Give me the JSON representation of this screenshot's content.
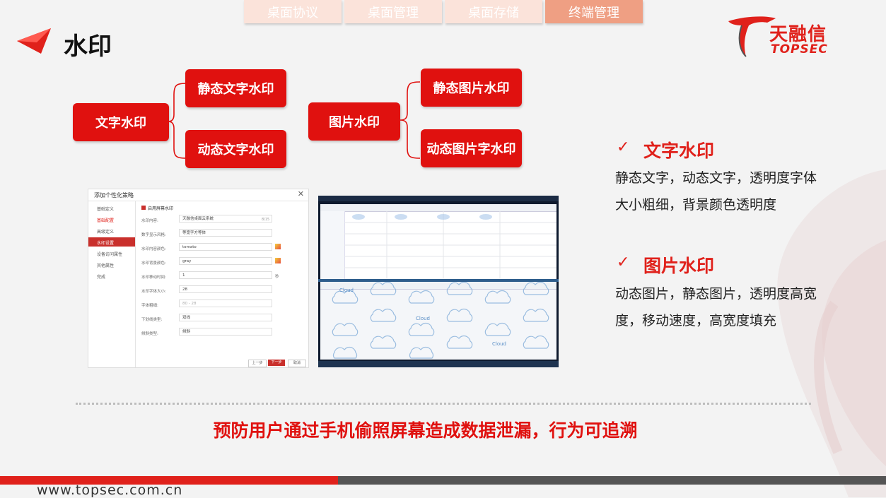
{
  "tabs": [
    {
      "label": "桌面协议",
      "active": false
    },
    {
      "label": "桌面管理",
      "active": false
    },
    {
      "label": "桌面存储",
      "active": false
    },
    {
      "label": "终端管理",
      "active": true
    }
  ],
  "page_title": "水印",
  "logo": {
    "cn": "天融信",
    "en": "TOPSEC"
  },
  "diagram": {
    "text_watermark": {
      "label": "文字水印",
      "children": [
        "静态文字水印",
        "动态文字水印"
      ]
    },
    "image_watermark": {
      "label": "图片水印",
      "children": [
        "静态图片水印",
        "动态图片字水印"
      ]
    }
  },
  "dialog": {
    "title": "添加个性化策略",
    "nav": [
      "基础定义",
      "基础配置",
      "高级定义",
      "水印设置",
      "设备访问属性",
      "其他属性",
      "完成"
    ],
    "enable_label": "启用屏幕水印",
    "fields": [
      {
        "label": "水印内容:",
        "value": "天融信桌面云系统",
        "extra": "8/15"
      },
      {
        "label": "数字显示风格:",
        "value": "等宽字方等体",
        "extra": ""
      },
      {
        "label": "水印内容颜色:",
        "value": "tomato",
        "extra": ""
      },
      {
        "label": "水印背景颜色:",
        "value": "gray",
        "extra": ""
      },
      {
        "label": "水印移动时间:",
        "value": "1",
        "extra": "秒"
      },
      {
        "label": "水印字体大小:",
        "value": "28",
        "extra": ""
      },
      {
        "label": "字体粗细:",
        "value": "80 - 28",
        "extra": ""
      },
      {
        "label": "下划线类型:",
        "value": "双线",
        "extra": ""
      },
      {
        "label": "倾斜类型:",
        "value": "倾斜",
        "extra": ""
      }
    ],
    "buttons": {
      "prev": "上一步",
      "next": "下一步",
      "cancel": "取消"
    }
  },
  "desktop_watermark_word": "Cloud",
  "right_panel": {
    "check_mark": "✓",
    "sections": [
      {
        "heading": "文字水印",
        "body": "静态文字，动态文字，透明度字体大小粗细，背景颜色透明度"
      },
      {
        "heading": "图片水印",
        "body": "动态图片，静态图片，透明度高宽度，移动速度，高宽度填充"
      }
    ]
  },
  "slogan": "预防用户通过手机偷照屏幕造成数据泄漏，行为可追溯",
  "footer_url": "www.topsec.com.cn",
  "colors": {
    "brand_red": "#e0110f",
    "tab_light": "#fbe3da",
    "tab_active": "#ef9f83"
  }
}
